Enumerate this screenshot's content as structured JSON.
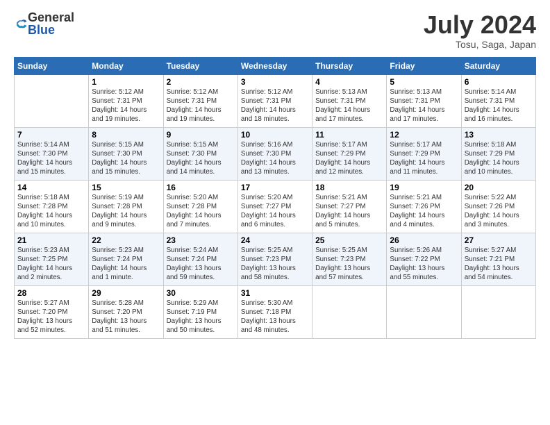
{
  "logo": {
    "general": "General",
    "blue": "Blue"
  },
  "title": "July 2024",
  "location": "Tosu, Saga, Japan",
  "days_of_week": [
    "Sunday",
    "Monday",
    "Tuesday",
    "Wednesday",
    "Thursday",
    "Friday",
    "Saturday"
  ],
  "weeks": [
    [
      {
        "date": "",
        "info": ""
      },
      {
        "date": "1",
        "info": "Sunrise: 5:12 AM\nSunset: 7:31 PM\nDaylight: 14 hours\nand 19 minutes."
      },
      {
        "date": "2",
        "info": "Sunrise: 5:12 AM\nSunset: 7:31 PM\nDaylight: 14 hours\nand 19 minutes."
      },
      {
        "date": "3",
        "info": "Sunrise: 5:12 AM\nSunset: 7:31 PM\nDaylight: 14 hours\nand 18 minutes."
      },
      {
        "date": "4",
        "info": "Sunrise: 5:13 AM\nSunset: 7:31 PM\nDaylight: 14 hours\nand 17 minutes."
      },
      {
        "date": "5",
        "info": "Sunrise: 5:13 AM\nSunset: 7:31 PM\nDaylight: 14 hours\nand 17 minutes."
      },
      {
        "date": "6",
        "info": "Sunrise: 5:14 AM\nSunset: 7:31 PM\nDaylight: 14 hours\nand 16 minutes."
      }
    ],
    [
      {
        "date": "7",
        "info": "Sunrise: 5:14 AM\nSunset: 7:30 PM\nDaylight: 14 hours\nand 15 minutes."
      },
      {
        "date": "8",
        "info": "Sunrise: 5:15 AM\nSunset: 7:30 PM\nDaylight: 14 hours\nand 15 minutes."
      },
      {
        "date": "9",
        "info": "Sunrise: 5:15 AM\nSunset: 7:30 PM\nDaylight: 14 hours\nand 14 minutes."
      },
      {
        "date": "10",
        "info": "Sunrise: 5:16 AM\nSunset: 7:30 PM\nDaylight: 14 hours\nand 13 minutes."
      },
      {
        "date": "11",
        "info": "Sunrise: 5:17 AM\nSunset: 7:29 PM\nDaylight: 14 hours\nand 12 minutes."
      },
      {
        "date": "12",
        "info": "Sunrise: 5:17 AM\nSunset: 7:29 PM\nDaylight: 14 hours\nand 11 minutes."
      },
      {
        "date": "13",
        "info": "Sunrise: 5:18 AM\nSunset: 7:29 PM\nDaylight: 14 hours\nand 10 minutes."
      }
    ],
    [
      {
        "date": "14",
        "info": "Sunrise: 5:18 AM\nSunset: 7:28 PM\nDaylight: 14 hours\nand 10 minutes."
      },
      {
        "date": "15",
        "info": "Sunrise: 5:19 AM\nSunset: 7:28 PM\nDaylight: 14 hours\nand 9 minutes."
      },
      {
        "date": "16",
        "info": "Sunrise: 5:20 AM\nSunset: 7:28 PM\nDaylight: 14 hours\nand 7 minutes."
      },
      {
        "date": "17",
        "info": "Sunrise: 5:20 AM\nSunset: 7:27 PM\nDaylight: 14 hours\nand 6 minutes."
      },
      {
        "date": "18",
        "info": "Sunrise: 5:21 AM\nSunset: 7:27 PM\nDaylight: 14 hours\nand 5 minutes."
      },
      {
        "date": "19",
        "info": "Sunrise: 5:21 AM\nSunset: 7:26 PM\nDaylight: 14 hours\nand 4 minutes."
      },
      {
        "date": "20",
        "info": "Sunrise: 5:22 AM\nSunset: 7:26 PM\nDaylight: 14 hours\nand 3 minutes."
      }
    ],
    [
      {
        "date": "21",
        "info": "Sunrise: 5:23 AM\nSunset: 7:25 PM\nDaylight: 14 hours\nand 2 minutes."
      },
      {
        "date": "22",
        "info": "Sunrise: 5:23 AM\nSunset: 7:24 PM\nDaylight: 14 hours\nand 1 minute."
      },
      {
        "date": "23",
        "info": "Sunrise: 5:24 AM\nSunset: 7:24 PM\nDaylight: 13 hours\nand 59 minutes."
      },
      {
        "date": "24",
        "info": "Sunrise: 5:25 AM\nSunset: 7:23 PM\nDaylight: 13 hours\nand 58 minutes."
      },
      {
        "date": "25",
        "info": "Sunrise: 5:25 AM\nSunset: 7:23 PM\nDaylight: 13 hours\nand 57 minutes."
      },
      {
        "date": "26",
        "info": "Sunrise: 5:26 AM\nSunset: 7:22 PM\nDaylight: 13 hours\nand 55 minutes."
      },
      {
        "date": "27",
        "info": "Sunrise: 5:27 AM\nSunset: 7:21 PM\nDaylight: 13 hours\nand 54 minutes."
      }
    ],
    [
      {
        "date": "28",
        "info": "Sunrise: 5:27 AM\nSunset: 7:20 PM\nDaylight: 13 hours\nand 52 minutes."
      },
      {
        "date": "29",
        "info": "Sunrise: 5:28 AM\nSunset: 7:20 PM\nDaylight: 13 hours\nand 51 minutes."
      },
      {
        "date": "30",
        "info": "Sunrise: 5:29 AM\nSunset: 7:19 PM\nDaylight: 13 hours\nand 50 minutes."
      },
      {
        "date": "31",
        "info": "Sunrise: 5:30 AM\nSunset: 7:18 PM\nDaylight: 13 hours\nand 48 minutes."
      },
      {
        "date": "",
        "info": ""
      },
      {
        "date": "",
        "info": ""
      },
      {
        "date": "",
        "info": ""
      }
    ]
  ]
}
